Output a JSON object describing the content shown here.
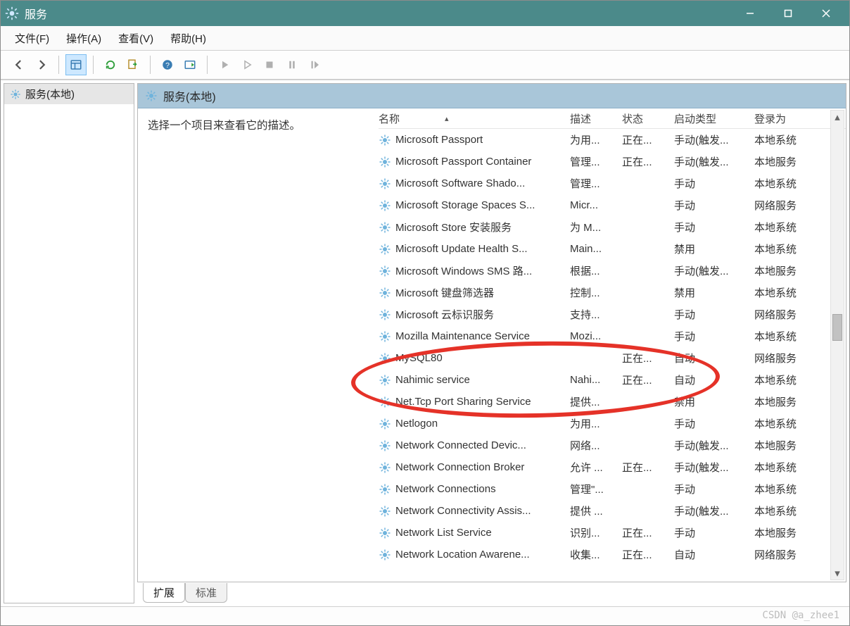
{
  "window": {
    "title": "服务"
  },
  "menubar": {
    "file": "文件(F)",
    "action": "操作(A)",
    "view": "查看(V)",
    "help": "帮助(H)"
  },
  "tree": {
    "root": "服务(本地)"
  },
  "right": {
    "header": "服务(本地)",
    "prompt": "选择一个项目来查看它的描述。"
  },
  "columns": {
    "name": "名称",
    "desc": "描述",
    "status": "状态",
    "type": "启动类型",
    "logon": "登录为"
  },
  "services": [
    {
      "name": "Microsoft Passport",
      "desc": "为用...",
      "status": "正在...",
      "type": "手动(触发...",
      "logon": "本地系统"
    },
    {
      "name": "Microsoft Passport Container",
      "desc": "管理...",
      "status": "正在...",
      "type": "手动(触发...",
      "logon": "本地服务"
    },
    {
      "name": "Microsoft Software Shado...",
      "desc": "管理...",
      "status": "",
      "type": "手动",
      "logon": "本地系统"
    },
    {
      "name": "Microsoft Storage Spaces S...",
      "desc": "Micr...",
      "status": "",
      "type": "手动",
      "logon": "网络服务"
    },
    {
      "name": "Microsoft Store 安装服务",
      "desc": "为 M...",
      "status": "",
      "type": "手动",
      "logon": "本地系统"
    },
    {
      "name": "Microsoft Update Health S...",
      "desc": "Main...",
      "status": "",
      "type": "禁用",
      "logon": "本地系统"
    },
    {
      "name": "Microsoft Windows SMS 路...",
      "desc": "根据...",
      "status": "",
      "type": "手动(触发...",
      "logon": "本地服务"
    },
    {
      "name": "Microsoft 键盘筛选器",
      "desc": "控制...",
      "status": "",
      "type": "禁用",
      "logon": "本地系统"
    },
    {
      "name": "Microsoft 云标识服务",
      "desc": "支持...",
      "status": "",
      "type": "手动",
      "logon": "网络服务"
    },
    {
      "name": "Mozilla Maintenance Service",
      "desc": "Mozi...",
      "status": "",
      "type": "手动",
      "logon": "本地系统"
    },
    {
      "name": "MySQL80",
      "desc": "",
      "status": "正在...",
      "type": "自动",
      "logon": "网络服务"
    },
    {
      "name": "Nahimic service",
      "desc": "Nahi...",
      "status": "正在...",
      "type": "自动",
      "logon": "本地系统"
    },
    {
      "name": "Net.Tcp Port Sharing Service",
      "desc": "提供...",
      "status": "",
      "type": "禁用",
      "logon": "本地服务"
    },
    {
      "name": "Netlogon",
      "desc": "为用...",
      "status": "",
      "type": "手动",
      "logon": "本地系统"
    },
    {
      "name": "Network Connected Devic...",
      "desc": "网络...",
      "status": "",
      "type": "手动(触发...",
      "logon": "本地服务"
    },
    {
      "name": "Network Connection Broker",
      "desc": "允许 ...",
      "status": "正在...",
      "type": "手动(触发...",
      "logon": "本地系统"
    },
    {
      "name": "Network Connections",
      "desc": "管理\"...",
      "status": "",
      "type": "手动",
      "logon": "本地系统"
    },
    {
      "name": "Network Connectivity Assis...",
      "desc": "提供 ...",
      "status": "",
      "type": "手动(触发...",
      "logon": "本地系统"
    },
    {
      "name": "Network List Service",
      "desc": "识别...",
      "status": "正在...",
      "type": "手动",
      "logon": "本地服务"
    },
    {
      "name": "Network Location Awarene...",
      "desc": "收集...",
      "status": "正在...",
      "type": "自动",
      "logon": "网络服务"
    }
  ],
  "tabs": {
    "ext": "扩展",
    "std": "标准"
  },
  "watermark": "CSDN @a_zhee1"
}
